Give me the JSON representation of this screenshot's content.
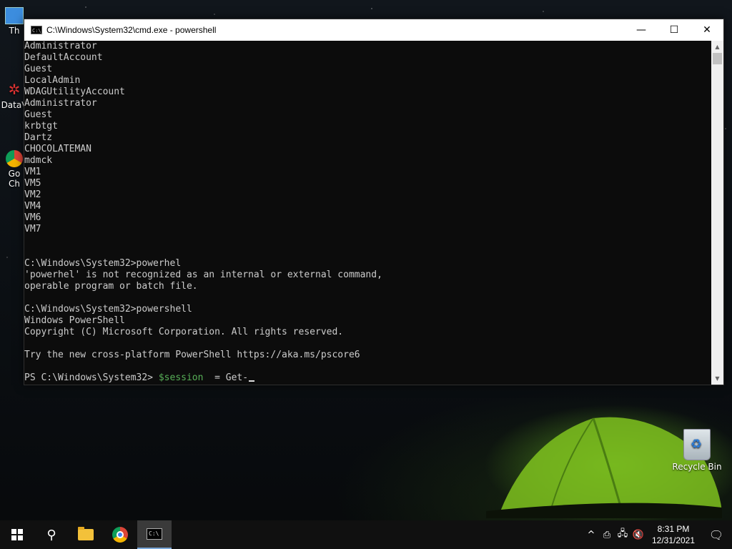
{
  "desktop": {
    "left_icons": [
      {
        "label": "Th"
      },
      {
        "label": "DataV"
      },
      {
        "label": "Go\nCh"
      }
    ],
    "recycle_bin_label": "Recycle Bin"
  },
  "window": {
    "title": "C:\\Windows\\System32\\cmd.exe - powershell",
    "app_icon_text": "C:\\_",
    "minimize_glyph": "—",
    "maximize_glyph": "☐",
    "close_glyph": "✕",
    "console_lines": [
      "Administrator",
      "DefaultAccount",
      "Guest",
      "LocalAdmin",
      "WDAGUtilityAccount",
      "Administrator",
      "Guest",
      "krbtgt",
      "Dartz",
      "CHOCOLATEMAN",
      "mdmck",
      "VM1",
      "VM5",
      "VM2",
      "VM4",
      "VM6",
      "VM7",
      "",
      "",
      "C:\\Windows\\System32>powerhel",
      "'powerhel' is not recognized as an internal or external command,",
      "operable program or batch file.",
      "",
      "C:\\Windows\\System32>powershell",
      "Windows PowerShell",
      "Copyright (C) Microsoft Corporation. All rights reserved.",
      "",
      "Try the new cross-platform PowerShell https://aka.ms/pscore6",
      ""
    ],
    "prompt": {
      "prefix": "PS C:\\Windows\\System32> ",
      "variable": "$session",
      "rest": "  = Get-"
    }
  },
  "taskbar": {
    "start_icon": "windows-logo",
    "search_glyph": "⚲",
    "clock_time": "8:31 PM",
    "clock_date": "12/31/2021",
    "tray_glyphs": [
      "^",
      "⎙",
      "🖧",
      "🔇"
    ],
    "notification_glyph": "🗨"
  }
}
